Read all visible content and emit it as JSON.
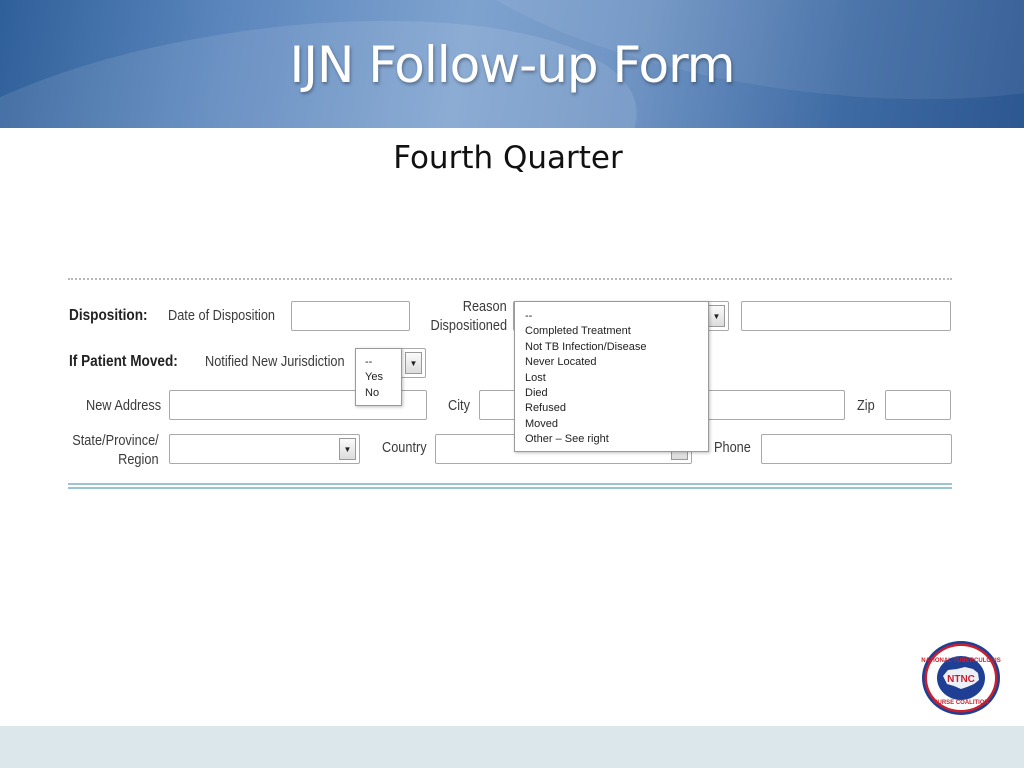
{
  "slide": {
    "title": "IJN Follow-up Form",
    "subtitle": "Fourth Quarter"
  },
  "form": {
    "disposition": {
      "section_label": "Disposition:",
      "date_label": "Date of Disposition",
      "reason_label_line1": "Reason",
      "reason_label_line2": "Dispositioned"
    },
    "patient_moved": {
      "section_label": "If Patient Moved:",
      "notified_label": "Notified New Jurisdiction",
      "new_address_label": "New Address",
      "city_label": "City",
      "zip_label": "Zip",
      "state_label_line1": "State/Province/",
      "state_label_line2": "Region",
      "country_label": "Country",
      "phone_label": "Phone"
    },
    "notified_options": [
      "--",
      "Yes",
      "No"
    ],
    "reason_options": [
      "--",
      "Completed Treatment",
      "Not TB Infection/Disease",
      "Never Located",
      "Lost",
      "Died",
      "Refused",
      "Moved",
      "Other – See right"
    ]
  },
  "logo": {
    "icon": "ntnc-seal-icon",
    "text_top": "NATIONAL TUBERCULOSIS",
    "text_center": "NTNC",
    "text_bottom": "NURSE COALITION"
  },
  "colors": {
    "header_blue": "#3f6ba4",
    "footer_band": "#dce7ec",
    "separator_teal": "#9cc5d4",
    "logo_red": "#c8202f",
    "logo_blue": "#1f3f94"
  }
}
